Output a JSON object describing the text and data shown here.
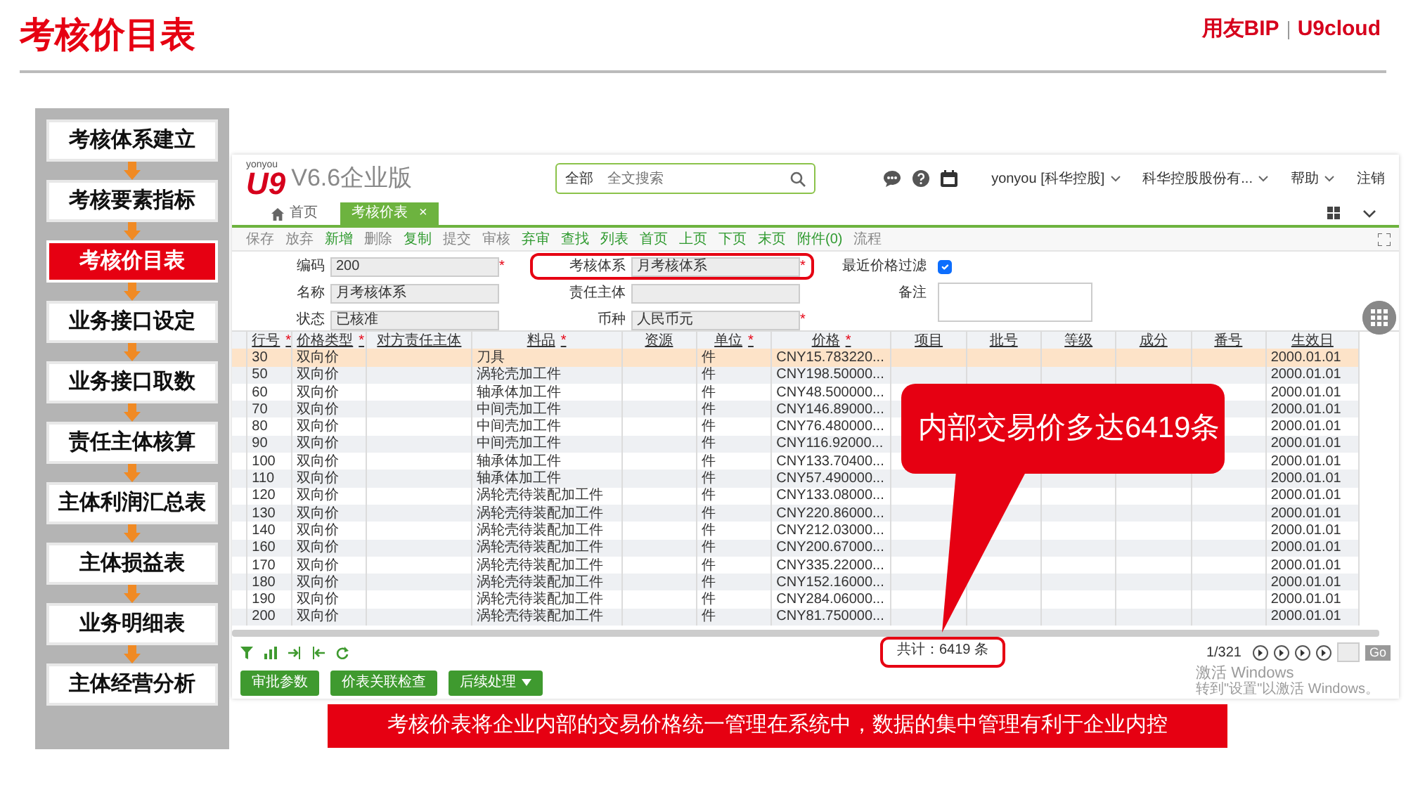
{
  "slide": {
    "title": "考核价目表",
    "brand": "用友BIP",
    "brand_product": "U9cloud"
  },
  "sidebar": {
    "items": [
      {
        "label": "考核体系建立",
        "selected": false
      },
      {
        "label": "考核要素指标",
        "selected": false
      },
      {
        "label": "考核价目表",
        "selected": true
      },
      {
        "label": "业务接口设定",
        "selected": false
      },
      {
        "label": "业务接口取数",
        "selected": false
      },
      {
        "label": "责任主体核算",
        "selected": false
      },
      {
        "label": "主体利润汇总表",
        "selected": false
      },
      {
        "label": "主体损益表",
        "selected": false
      },
      {
        "label": "业务明细表",
        "selected": false
      },
      {
        "label": "主体经营分析",
        "selected": false
      }
    ]
  },
  "app": {
    "vendor": "yonyou",
    "logo": "U9",
    "version": "V6.6企业版",
    "search": {
      "scope": "全部",
      "placeholder": "全文搜索"
    },
    "user_menu": [
      {
        "label": "yonyou [科华控股]",
        "caret": true
      },
      {
        "label": "科华控股股份有...",
        "caret": true
      },
      {
        "label": "帮助",
        "caret": true
      },
      {
        "label": "注销",
        "caret": false
      }
    ],
    "tabs": [
      {
        "label": "首页",
        "kind": "home",
        "selected": false,
        "closable": false
      },
      {
        "label": "考核价表",
        "kind": "page",
        "selected": true,
        "closable": true,
        "close": "×"
      }
    ],
    "toolbar": [
      {
        "label": "保存",
        "enabled": false
      },
      {
        "label": "放弃",
        "enabled": false
      },
      {
        "label": "新增",
        "enabled": true
      },
      {
        "label": "删除",
        "enabled": false
      },
      {
        "label": "复制",
        "enabled": true
      },
      {
        "label": "提交",
        "enabled": false
      },
      {
        "label": "审核",
        "enabled": false
      },
      {
        "label": "弃审",
        "enabled": true
      },
      {
        "label": "查找",
        "enabled": true
      },
      {
        "label": "列表",
        "enabled": true
      },
      {
        "label": "首页",
        "enabled": true
      },
      {
        "label": "上页",
        "enabled": true
      },
      {
        "label": "下页",
        "enabled": true
      },
      {
        "label": "末页",
        "enabled": true
      },
      {
        "label": "附件(0)",
        "enabled": true
      },
      {
        "label": "流程",
        "enabled": false
      }
    ],
    "form": {
      "columns": [
        [
          {
            "label": "编码",
            "value": "200",
            "required_mark": "*",
            "highlighted": false
          },
          {
            "label": "名称",
            "value": "月考核体系",
            "highlighted": false
          },
          {
            "label": "状态",
            "value": "已核准",
            "highlighted": false
          }
        ],
        [
          {
            "label": "考核体系",
            "value": "月考核体系",
            "required_mark": "*",
            "highlighted": true
          },
          {
            "label": "责任主体",
            "highlighted": false
          },
          {
            "label": "币种",
            "value": "人民币元",
            "required_mark": "*",
            "highlighted": false
          }
        ]
      ],
      "filter": {
        "label": "最近价格过滤",
        "checked": true
      },
      "note": {
        "label": "备注"
      }
    },
    "table": {
      "columns": [
        {
          "label": "行号",
          "required_mark": "*"
        },
        {
          "label": "价格类型",
          "required_mark": "*"
        },
        {
          "label": "对方责任主体"
        },
        {
          "label": "料品",
          "required_mark": "*"
        },
        {
          "label": "资源"
        },
        {
          "label": "单位",
          "required_mark": "*"
        },
        {
          "label": "价格",
          "required_mark": "*"
        },
        {
          "label": "项目"
        },
        {
          "label": "批号"
        },
        {
          "label": "等级"
        },
        {
          "label": "成分"
        },
        {
          "label": "番号"
        },
        {
          "label": "生效日"
        }
      ],
      "rows": [
        {
          "selected": true,
          "line": "30",
          "price_type": "双向价",
          "item": "刀具",
          "unit": "件",
          "price": "CNY15.783220...",
          "column_13": "2000.01.01"
        },
        {
          "selected": false,
          "line": "50",
          "price_type": "双向价",
          "item": "涡轮壳加工件",
          "unit": "件",
          "price": "CNY198.50000...",
          "column_13": "2000.01.01"
        },
        {
          "selected": false,
          "line": "60",
          "price_type": "双向价",
          "item": "轴承体加工件",
          "unit": "件",
          "price": "CNY48.500000...",
          "column_13": "2000.01.01"
        },
        {
          "selected": false,
          "line": "70",
          "price_type": "双向价",
          "item": "中间壳加工件",
          "unit": "件",
          "price": "CNY146.89000...",
          "column_13": "2000.01.01"
        },
        {
          "selected": false,
          "line": "80",
          "price_type": "双向价",
          "item": "中间壳加工件",
          "unit": "件",
          "price": "CNY76.480000...",
          "column_13": "2000.01.01"
        },
        {
          "selected": false,
          "line": "90",
          "price_type": "双向价",
          "item": "中间壳加工件",
          "unit": "件",
          "price": "CNY116.92000...",
          "column_13": "2000.01.01"
        },
        {
          "selected": false,
          "line": "100",
          "price_type": "双向价",
          "item": "轴承体加工件",
          "unit": "件",
          "price": "CNY133.70400...",
          "column_13": "2000.01.01"
        },
        {
          "selected": false,
          "line": "110",
          "price_type": "双向价",
          "item": "轴承体加工件",
          "unit": "件",
          "price": "CNY57.490000...",
          "column_13": "2000.01.01"
        },
        {
          "selected": false,
          "line": "120",
          "price_type": "双向价",
          "item": "涡轮壳待装配加工件",
          "unit": "件",
          "price": "CNY133.08000...",
          "column_13": "2000.01.01"
        },
        {
          "selected": false,
          "line": "130",
          "price_type": "双向价",
          "item": "涡轮壳待装配加工件",
          "unit": "件",
          "price": "CNY220.86000...",
          "column_13": "2000.01.01"
        },
        {
          "selected": false,
          "line": "140",
          "price_type": "双向价",
          "item": "涡轮壳待装配加工件",
          "unit": "件",
          "price": "CNY212.03000...",
          "column_13": "2000.01.01"
        },
        {
          "selected": false,
          "line": "160",
          "price_type": "双向价",
          "item": "涡轮壳待装配加工件",
          "unit": "件",
          "price": "CNY200.67000...",
          "column_13": "2000.01.01"
        },
        {
          "selected": false,
          "line": "170",
          "price_type": "双向价",
          "item": "涡轮壳待装配加工件",
          "unit": "件",
          "price": "CNY335.22000...",
          "column_13": "2000.01.01"
        },
        {
          "selected": false,
          "line": "180",
          "price_type": "双向价",
          "item": "涡轮壳待装配加工件",
          "unit": "件",
          "price": "CNY152.16000...",
          "column_13": "2000.01.01"
        },
        {
          "selected": false,
          "line": "190",
          "price_type": "双向价",
          "item": "涡轮壳待装配加工件",
          "unit": "件",
          "price": "CNY284.06000...",
          "column_13": "2000.01.01"
        },
        {
          "selected": false,
          "line": "200",
          "price_type": "双向价",
          "item": "涡轮壳待装配加工件",
          "unit": "件",
          "price": "CNY81.750000...",
          "column_13": "2000.01.01"
        }
      ]
    },
    "total": {
      "text": "共计：6419 条",
      "highlighted": true
    },
    "pager": {
      "text": "1/321",
      "go": "Go"
    },
    "activation_notice": {
      "title": "激活 Windows",
      "text": "转到\"设置\"以激活 Windows。"
    },
    "actions": [
      {
        "label": "审批参数",
        "dropdown": false
      },
      {
        "label": "价表关联检查",
        "dropdown": false
      },
      {
        "label": "后续处理",
        "dropdown": true
      }
    ]
  },
  "callout": {
    "text": "内部交易价多达6419条"
  },
  "caption": "考核价表将企业内部的交易价格统一管理在系统中，数据的集中管理有利于企业内控"
}
